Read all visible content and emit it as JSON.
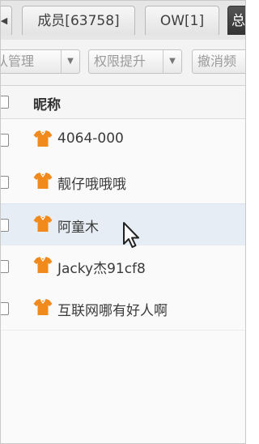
{
  "tabs": {
    "scroll_left_glyph": "◀",
    "members_label": "成员[63758]",
    "ow_label": "OW[1]",
    "partial_label": "总"
  },
  "toolbar": {
    "team_manage_label": "队管理",
    "permission_label": "权限提升",
    "revoke_label": "撤消频"
  },
  "table": {
    "column_title": "昵称"
  },
  "members": [
    {
      "nickname": "4064-000"
    },
    {
      "nickname": "靓仔哦哦哦"
    },
    {
      "nickname": "阿童木",
      "selected": true
    },
    {
      "nickname": "Jacky杰91cf8"
    },
    {
      "nickname": "互联网哪有好人啊"
    }
  ],
  "colors": {
    "shirt_icon": "#f08a1c",
    "selected_row": "#e7edf4"
  }
}
